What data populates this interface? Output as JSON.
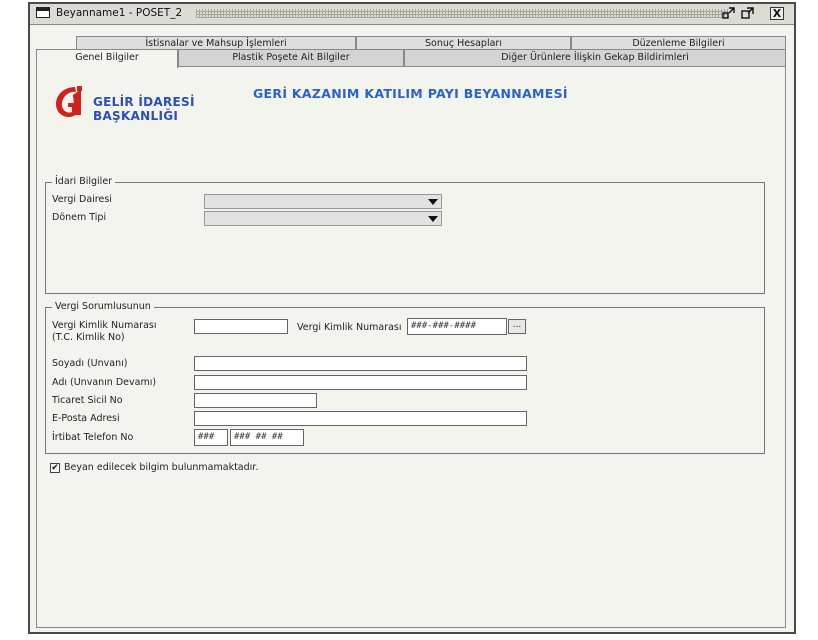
{
  "window": {
    "title": "Beyanname1 - POSET_2",
    "minimize_icon": "restore-down-icon",
    "maximize_icon": "maximize-icon",
    "close_label": "X"
  },
  "tabs": {
    "row1": [
      "İstisnalar ve Mahsup İşlemleri",
      "Sonuç Hesapları",
      "Düzenleme Bilgileri"
    ],
    "row2": [
      "Genel Bilgiler",
      "Plastik Poşete Ait Bilgiler",
      "Diğer Ürünlere İlişkin Gekap Bildirimleri"
    ]
  },
  "header": {
    "logo_line1": "GELİR İDARESİ",
    "logo_line2": "BAŞKANLIĞI",
    "title": "GERİ KAZANIM KATILIM PAYI BEYANNAMESİ",
    "logo_color": "#d0231f",
    "title_color": "#2b63c8"
  },
  "idari": {
    "legend": "İdari Bilgiler",
    "vergi_dairesi_label": "Vergi Dairesi",
    "vergi_dairesi_value": "",
    "donem_tipi_label": "Dönem Tipi",
    "donem_tipi_value": ""
  },
  "sorumlu": {
    "legend": "Vergi Sorumlusunun",
    "tckn_label_1": "Vergi Kimlik Numarası",
    "tckn_label_2": "(T.C. Kimlik No)",
    "tckn_value": "",
    "vkn_label": "Vergi Kimlik Numarası",
    "vkn_mask": "###-###-####",
    "lookup_label": "...",
    "soyadi_label": "Soyadı (Unvanı)",
    "adi_label": "Adı (Unvanın Devamı)",
    "ticaret_label": "Ticaret Sicil No",
    "eposta_label": "E-Posta Adresi",
    "telefon_label": "İrtibat Telefon No",
    "tel_area_mask": "###",
    "tel_number_mask": "### ## ##"
  },
  "beyan": {
    "checked": true,
    "check_mark": "✔",
    "label": "Beyan edilecek bilgim bulunmamaktadır."
  }
}
